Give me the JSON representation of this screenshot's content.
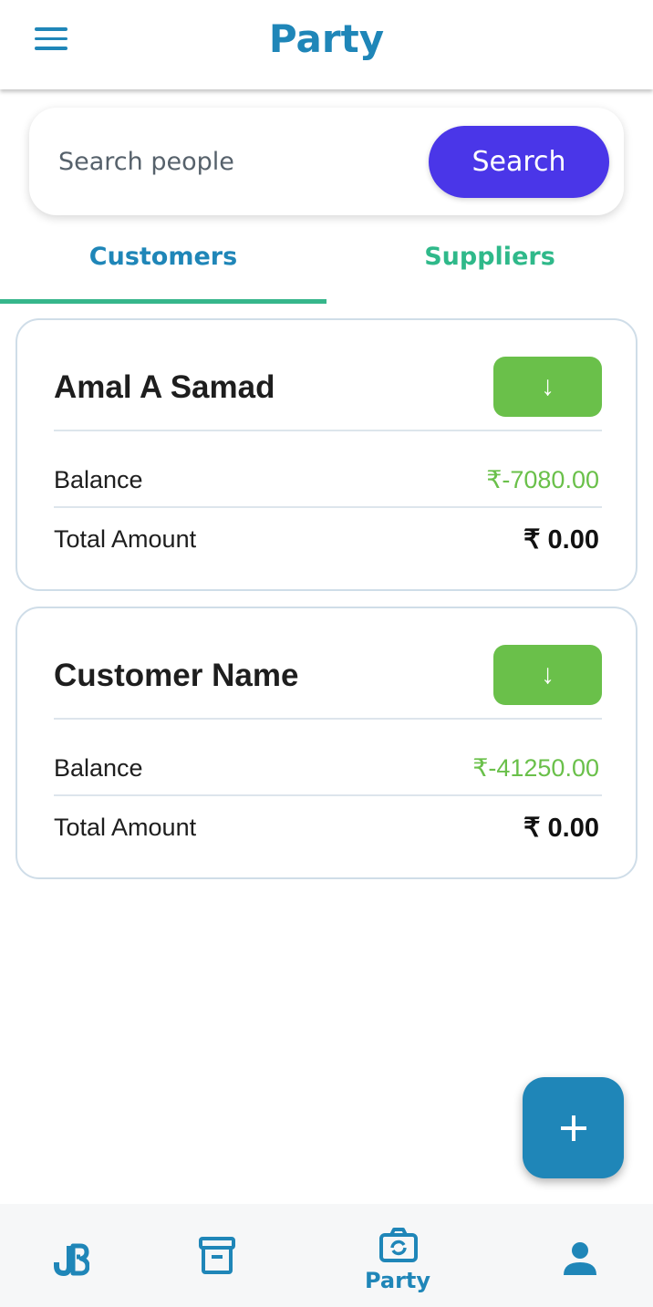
{
  "header": {
    "title": "Party"
  },
  "search": {
    "placeholder": "Search people",
    "button_label": "Search"
  },
  "tabs": [
    {
      "label": "Customers",
      "active": true
    },
    {
      "label": "Suppliers",
      "active": false
    }
  ],
  "parties": [
    {
      "name": "Amal A Samad",
      "arrow": "↓",
      "balance_label": "Balance",
      "balance": "₹-7080.00",
      "total_label": "Total Amount",
      "total": "₹ 0.00"
    },
    {
      "name": "Customer Name",
      "arrow": "↓",
      "balance_label": "Balance",
      "balance": "₹-41250.00",
      "total_label": "Total Amount",
      "total": "₹ 0.00"
    }
  ],
  "bottom_nav": {
    "items": [
      {
        "icon": "brand-logo-icon",
        "label": ""
      },
      {
        "icon": "archive-icon",
        "label": ""
      },
      {
        "icon": "party-icon",
        "label": "Party",
        "active": true
      },
      {
        "icon": "person-icon",
        "label": ""
      }
    ]
  },
  "colors": {
    "primary": "#1f86b8",
    "search_button": "#4a36e8",
    "tab_indicator": "#36b68b",
    "balance_green": "#6ac04a",
    "card_border": "#cfdde8"
  }
}
